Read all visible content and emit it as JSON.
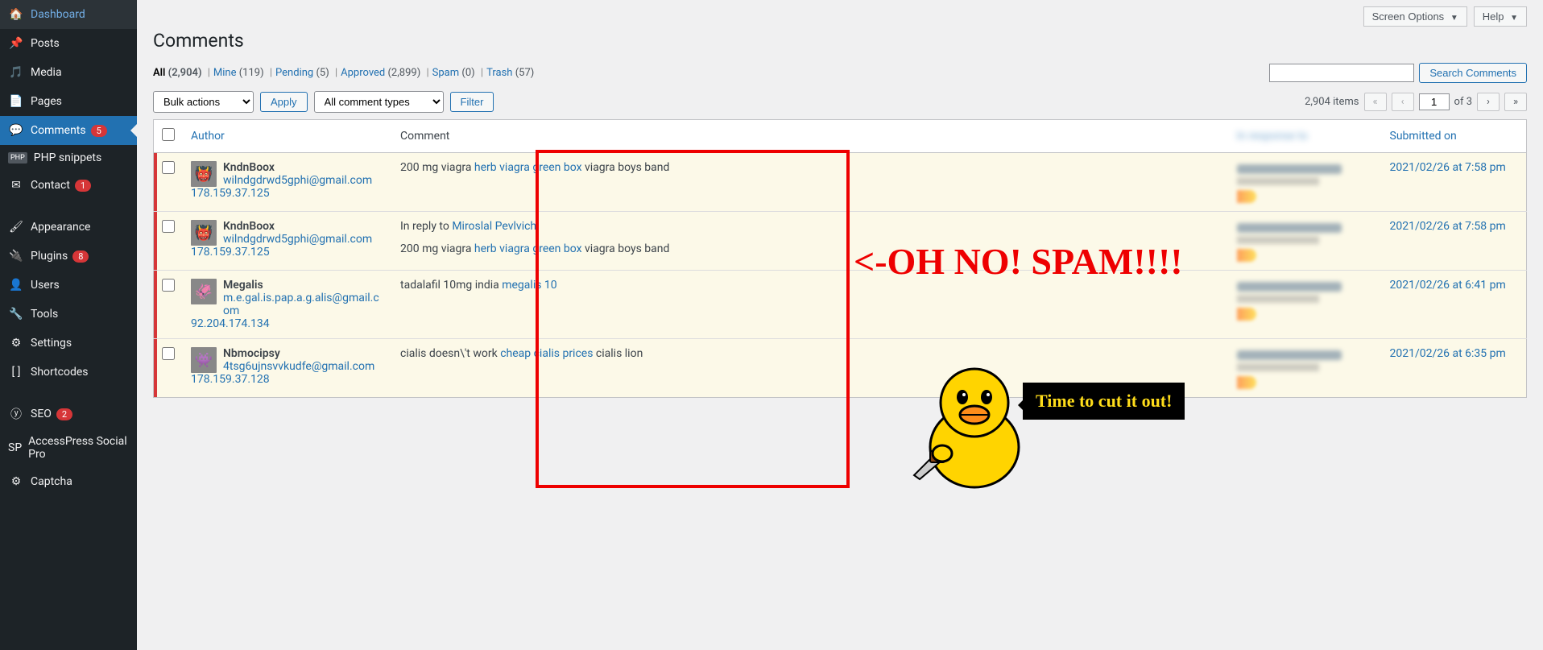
{
  "sidebar": {
    "items": [
      {
        "label": "Dashboard",
        "icon": "dashboard"
      },
      {
        "label": "Posts",
        "icon": "pin"
      },
      {
        "label": "Media",
        "icon": "media"
      },
      {
        "label": "Pages",
        "icon": "pages"
      },
      {
        "label": "Comments",
        "icon": "comment",
        "badge": "5",
        "active": true
      },
      {
        "label": "PHP snippets",
        "icon": "php"
      },
      {
        "label": "Contact",
        "icon": "mail",
        "badge": "1"
      },
      {
        "label": "Appearance",
        "icon": "brush"
      },
      {
        "label": "Plugins",
        "icon": "plug",
        "badge": "8"
      },
      {
        "label": "Users",
        "icon": "user"
      },
      {
        "label": "Tools",
        "icon": "wrench"
      },
      {
        "label": "Settings",
        "icon": "sliders"
      },
      {
        "label": "Shortcodes",
        "icon": "brackets"
      },
      {
        "label": "SEO",
        "icon": "seo",
        "badge": "2"
      },
      {
        "label": "AccessPress Social Pro",
        "icon": "sp"
      },
      {
        "label": "Captcha",
        "icon": "gear"
      }
    ]
  },
  "page": {
    "title": "Comments",
    "screen_options": "Screen Options",
    "help": "Help"
  },
  "filters": [
    {
      "label": "All",
      "count": "(2,904)",
      "current": true
    },
    {
      "label": "Mine",
      "count": "(119)"
    },
    {
      "label": "Pending",
      "count": "(5)"
    },
    {
      "label": "Approved",
      "count": "(2,899)"
    },
    {
      "label": "Spam",
      "count": "(0)"
    },
    {
      "label": "Trash",
      "count": "(57)"
    }
  ],
  "search": {
    "button": "Search Comments"
  },
  "actions": {
    "bulk": "Bulk actions",
    "apply": "Apply",
    "types": "All comment types",
    "filter": "Filter"
  },
  "pagination": {
    "items_text": "2,904 items",
    "page": "1",
    "of": "of 3"
  },
  "columns": {
    "author": "Author",
    "comment": "Comment",
    "response": "In response to",
    "submitted": "Submitted on"
  },
  "rows": [
    {
      "author": "KndnBoox",
      "email": "wilndgdrwd5gphi@gmail.com",
      "ip": "178.159.37.125",
      "avatar": "👹",
      "comment_pre": "200 mg viagra ",
      "comment_link": "herb viagra green box",
      "comment_post": " viagra boys band",
      "date": "2021/02/26 at 7:58 pm",
      "unapproved": true
    },
    {
      "author": "KndnBoox",
      "email": "wilndgdrwd5gphi@gmail.com",
      "ip": "178.159.37.125",
      "avatar": "👹",
      "reply_to_pre": "In reply to ",
      "reply_to_link": "Miroslal Pevlvich",
      "reply_to_post": ".",
      "comment_pre": "200 mg viagra ",
      "comment_link": "herb viagra green box",
      "comment_post": " viagra boys band",
      "date": "2021/02/26 at 7:58 pm",
      "unapproved": true
    },
    {
      "author": "Megalis",
      "email": "m.e.gal.is.pap.a.g.alis@gmail.com",
      "ip": "92.204.174.134",
      "avatar": "🦑",
      "comment_pre": "tadalafil 10mg india ",
      "comment_link": "megalis 10",
      "comment_post": "",
      "date": "2021/02/26 at 6:41 pm",
      "unapproved": true
    },
    {
      "author": "Nbmocipsy",
      "email": "4tsg6ujnsvvkudfe@gmail.com",
      "ip": "178.159.37.128",
      "avatar": "👾",
      "comment_pre": "cialis doesn\\'t work ",
      "comment_link": "cheap cialis prices",
      "comment_post": " cialis lion",
      "date": "2021/02/26 at 6:35 pm",
      "unapproved": true
    }
  ],
  "annotation": {
    "headline": "<-OH NO! SPAM!!!!",
    "speech": "Time to cut it out!"
  }
}
